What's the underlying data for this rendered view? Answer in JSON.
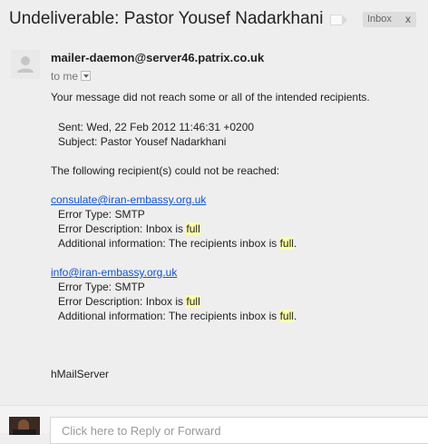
{
  "header": {
    "subject": "Undeliverable: Pastor Yousef Nadarkhani",
    "label": "Inbox",
    "label_remove": "x"
  },
  "message": {
    "sender": "mailer-daemon@server46.patrix.co.uk",
    "to": "to me",
    "intro": "Your message did not reach some or all of the intended recipients.",
    "sent": "Sent: Wed, 22 Feb 2012 11:46:31 +0200",
    "subject_line": "Subject: Pastor Yousef Nadarkhani",
    "failed_intro": "The following recipient(s) could not be reached:",
    "recipients": [
      {
        "email": "consulate@iran-embassy.org.uk",
        "error_type": "Error Type: SMTP",
        "desc_prefix": "Error Description: Inbox is ",
        "desc_highlight": "full",
        "info_prefix": "Additional information: The recipients inbox is ",
        "info_highlight": "full",
        "info_suffix": "."
      },
      {
        "email": "info@iran-embassy.org.uk",
        "error_type": "Error Type: SMTP",
        "desc_prefix": "Error Description: Inbox is ",
        "desc_highlight": "full",
        "info_prefix": "Additional information: The recipients inbox is ",
        "info_highlight": "full",
        "info_suffix": "."
      }
    ],
    "signature": "hMailServer"
  },
  "reply": {
    "placeholder": "Click here to Reply or Forward"
  },
  "colors": {
    "link": "#1155cc",
    "highlight": "#ffffaa",
    "chip": "#dddddd"
  },
  "icons": {
    "avatar": "default-person-icon",
    "label": "label-tag-icon",
    "dropdown": "chevron-down-icon"
  }
}
